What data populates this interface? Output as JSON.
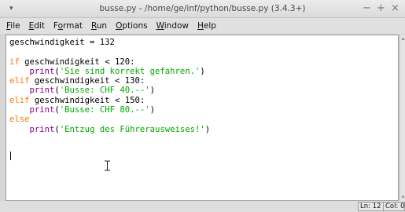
{
  "window": {
    "title": "busse.py - /home/ge/inf/python/busse.py (3.4.3+)",
    "menu_icon": "▾",
    "minimize": "−",
    "maximize": "+",
    "close": "×"
  },
  "menubar": {
    "items": [
      {
        "mnemonic": "F",
        "rest": "ile"
      },
      {
        "mnemonic": "E",
        "rest": "dit"
      },
      {
        "pre": "F",
        "mnemonic": "o",
        "rest": "rmat"
      },
      {
        "mnemonic": "R",
        "rest": "un"
      },
      {
        "mnemonic": "O",
        "rest": "ptions"
      },
      {
        "mnemonic": "W",
        "rest": "indow"
      },
      {
        "mnemonic": "H",
        "rest": "elp"
      }
    ]
  },
  "editor": {
    "lines": [
      [
        {
          "t": "txt",
          "s": "geschwindigkeit = 132"
        }
      ],
      [
        {
          "t": "txt",
          "s": ""
        }
      ],
      [
        {
          "t": "kw",
          "s": "if"
        },
        {
          "t": "txt",
          "s": " geschwindigkeit < 120:"
        }
      ],
      [
        {
          "t": "txt",
          "s": "    "
        },
        {
          "t": "bi",
          "s": "print"
        },
        {
          "t": "txt",
          "s": "("
        },
        {
          "t": "str",
          "s": "'Sie sind korrekt gefahren.'"
        },
        {
          "t": "txt",
          "s": ")"
        }
      ],
      [
        {
          "t": "kw",
          "s": "elif"
        },
        {
          "t": "txt",
          "s": " geschwindigkeit < 130:"
        }
      ],
      [
        {
          "t": "txt",
          "s": "    "
        },
        {
          "t": "bi",
          "s": "print"
        },
        {
          "t": "txt",
          "s": "("
        },
        {
          "t": "str",
          "s": "'Busse: CHF 40.--'"
        },
        {
          "t": "txt",
          "s": ")"
        }
      ],
      [
        {
          "t": "kw",
          "s": "elif"
        },
        {
          "t": "txt",
          "s": " geschwindigkeit < 150:"
        }
      ],
      [
        {
          "t": "txt",
          "s": "    "
        },
        {
          "t": "bi",
          "s": "print"
        },
        {
          "t": "txt",
          "s": "("
        },
        {
          "t": "str",
          "s": "'Busse: CHF 80.--'"
        },
        {
          "t": "txt",
          "s": ")"
        }
      ],
      [
        {
          "t": "kw",
          "s": "else"
        }
      ],
      [
        {
          "t": "txt",
          "s": "    "
        },
        {
          "t": "bi",
          "s": "print"
        },
        {
          "t": "txt",
          "s": "("
        },
        {
          "t": "str",
          "s": "'Entzug des Führerausweises!'"
        },
        {
          "t": "txt",
          "s": ")"
        }
      ]
    ]
  },
  "status": {
    "line": "Ln: 12",
    "col": "Col: 0"
  },
  "colors": {
    "keyword": "#ff7700",
    "builtin": "#900090",
    "string": "#00aa00"
  }
}
